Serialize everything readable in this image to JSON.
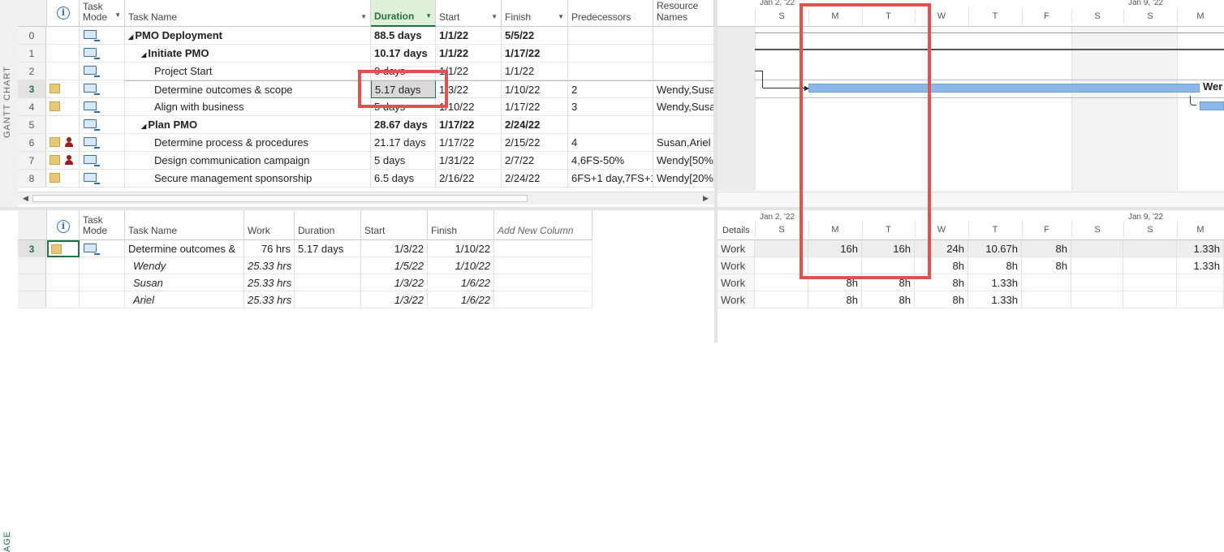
{
  "side_labels": {
    "top": "GANTT CHART",
    "bottom": "AGE"
  },
  "gantt": {
    "headers": {
      "mode": "Task Mode",
      "name": "Task Name",
      "duration": "Duration",
      "start": "Start",
      "finish": "Finish",
      "pred": "Predecessors",
      "res": "Resource Names"
    },
    "rows": [
      {
        "id": "0",
        "name": "PMO Deployment",
        "duration": "88.5 days",
        "start": "1/1/22",
        "finish": "5/5/22",
        "pred": "",
        "res": ""
      },
      {
        "id": "1",
        "name": "Initiate PMO",
        "duration": "10.17 days",
        "start": "1/1/22",
        "finish": "1/17/22",
        "pred": "",
        "res": ""
      },
      {
        "id": "2",
        "name": "Project Start",
        "duration": "0 days",
        "start": "1/1/22",
        "finish": "1/1/22",
        "pred": "",
        "res": ""
      },
      {
        "id": "3",
        "name": "Determine outcomes & scope",
        "duration": "5.17 days",
        "start": "1/3/22",
        "finish": "1/10/22",
        "pred": "2",
        "res": "Wendy,Susa"
      },
      {
        "id": "4",
        "name": "Align with business",
        "duration": "5 days",
        "start": "1/10/22",
        "finish": "1/17/22",
        "pred": "3",
        "res": "Wendy,Susa"
      },
      {
        "id": "5",
        "name": "Plan PMO",
        "duration": "28.67 days",
        "start": "1/17/22",
        "finish": "2/24/22",
        "pred": "",
        "res": ""
      },
      {
        "id": "6",
        "name": "Determine process & procedures",
        "duration": "21.17 days",
        "start": "1/17/22",
        "finish": "2/15/22",
        "pred": "4",
        "res": "Susan,Ariel"
      },
      {
        "id": "7",
        "name": "Design communication campaign",
        "duration": "5 days",
        "start": "1/31/22",
        "finish": "2/7/22",
        "pred": "4,6FS-50%",
        "res": "Wendy[50%"
      },
      {
        "id": "8",
        "name": "Secure management sponsorship",
        "duration": "6.5 days",
        "start": "2/16/22",
        "finish": "2/24/22",
        "pred": "6FS+1 day,7FS+1",
        "res": "Wendy[20%"
      }
    ],
    "timescale": {
      "week1": "Jan 2, '22",
      "week2": "Jan 9, '22",
      "days": [
        "S",
        "M",
        "T",
        "W",
        "T",
        "F",
        "S",
        "S",
        "M"
      ]
    },
    "bar_label": "Wer"
  },
  "usage": {
    "headers": {
      "mode": "Task Mode",
      "name": "Task Name",
      "work": "Work",
      "duration": "Duration",
      "start": "Start",
      "finish": "Finish",
      "add": "Add New Column"
    },
    "task": {
      "id": "3",
      "name": "Determine outcomes &",
      "work": "76 hrs",
      "duration": "5.17 days",
      "start": "1/3/22",
      "finish": "1/10/22"
    },
    "assignments": [
      {
        "name": "Wendy",
        "work": "25.33 hrs",
        "start": "1/5/22",
        "finish": "1/10/22"
      },
      {
        "name": "Susan",
        "work": "25.33 hrs",
        "start": "1/3/22",
        "finish": "1/6/22"
      },
      {
        "name": "Ariel",
        "work": "25.33 hrs",
        "start": "1/3/22",
        "finish": "1/6/22"
      }
    ],
    "timescale": {
      "details": "Details",
      "week1": "Jan 2, '22",
      "week2": "Jan 9, '22",
      "days": [
        "S",
        "M",
        "T",
        "W",
        "T",
        "F",
        "S",
        "S",
        "M"
      ]
    },
    "grid": [
      {
        "label": "Work",
        "vals": [
          "",
          "16h",
          "16h",
          "24h",
          "10.67h",
          "8h",
          "",
          "",
          "1.33h"
        ]
      },
      {
        "label": "Work",
        "vals": [
          "",
          "",
          "",
          "8h",
          "8h",
          "8h",
          "",
          "",
          "1.33h"
        ]
      },
      {
        "label": "Work",
        "vals": [
          "",
          "8h",
          "8h",
          "8h",
          "1.33h",
          "",
          "",
          "",
          ""
        ]
      },
      {
        "label": "Work",
        "vals": [
          "",
          "8h",
          "8h",
          "8h",
          "1.33h",
          "",
          "",
          "",
          ""
        ]
      }
    ]
  }
}
